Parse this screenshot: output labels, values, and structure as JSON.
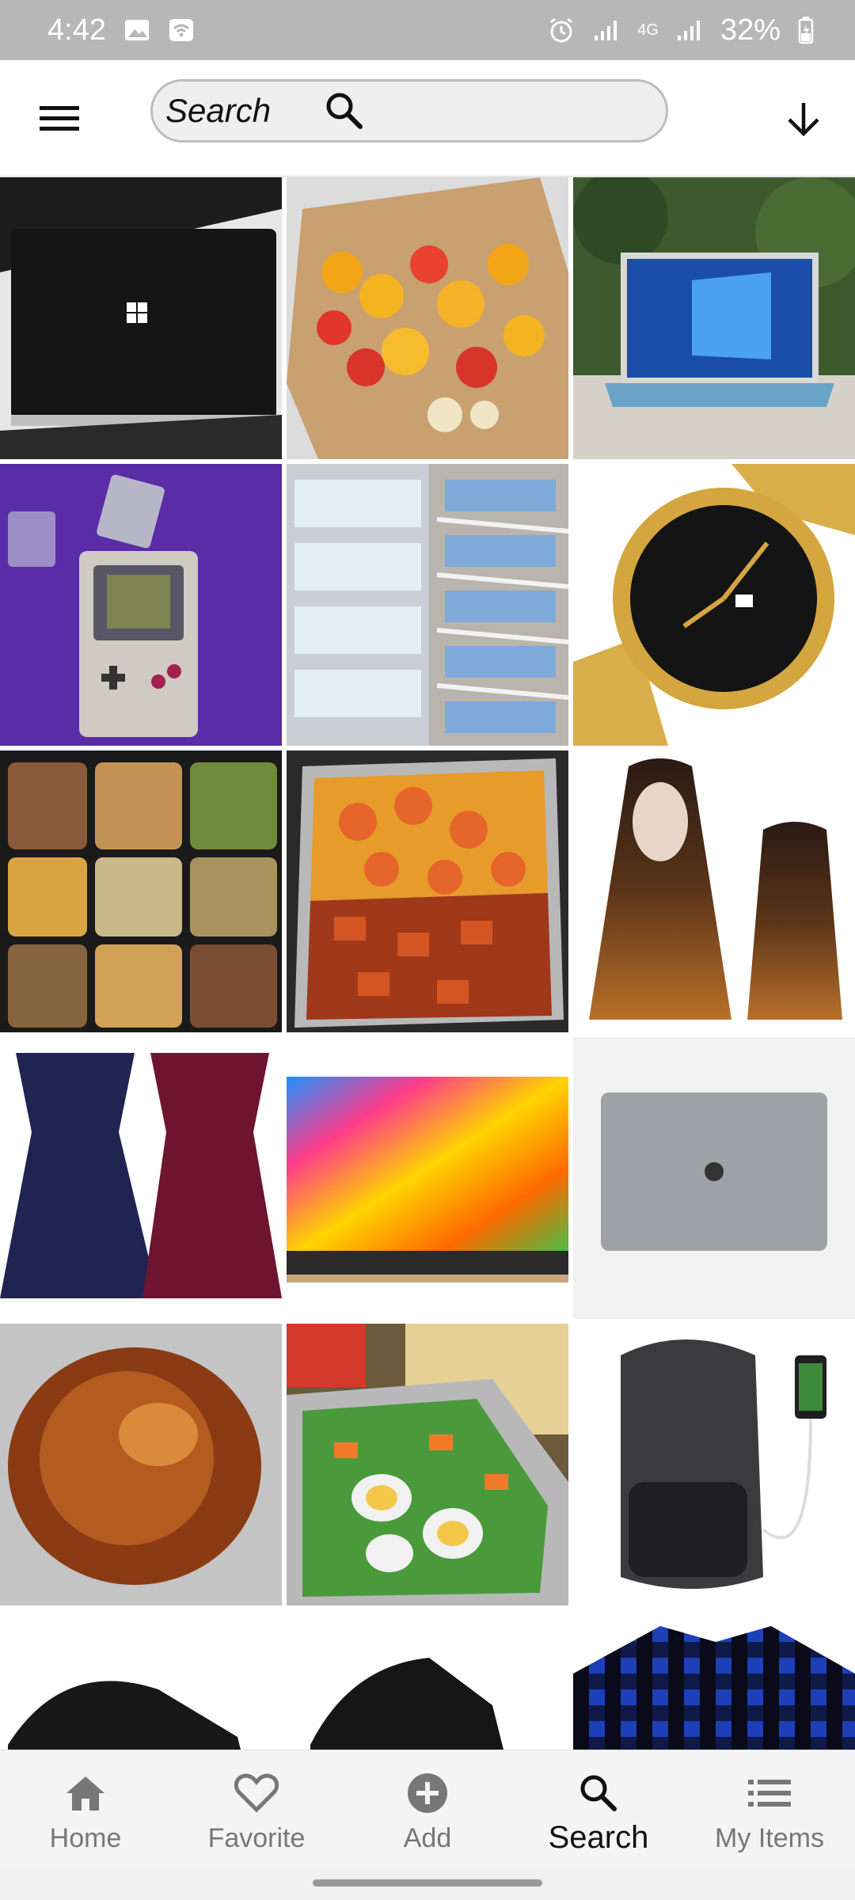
{
  "status_bar": {
    "time": "4:42",
    "battery": "32%",
    "network": "4G",
    "icons": [
      "image-icon",
      "wifi-icon",
      "alarm-icon",
      "signal-icon",
      "battery-icon"
    ]
  },
  "search": {
    "placeholder": "Search"
  },
  "grid": {
    "items": [
      {
        "name": "black-laptop"
      },
      {
        "name": "fruit-platter"
      },
      {
        "name": "surface-laptop"
      },
      {
        "name": "game-boy"
      },
      {
        "name": "water-bottles-fridge"
      },
      {
        "name": "gold-wristwatch"
      },
      {
        "name": "meal-prep-containers"
      },
      {
        "name": "shrimp-noodles-tray"
      },
      {
        "name": "ombre-wigs"
      },
      {
        "name": "off-shoulder-dresses"
      },
      {
        "name": "colorful-laptop"
      },
      {
        "name": "silver-macbook"
      },
      {
        "name": "roasted-chicken"
      },
      {
        "name": "salad-platter"
      },
      {
        "name": "backpack-usb"
      },
      {
        "name": "black-sneaker"
      },
      {
        "name": "black-sneaker-2"
      },
      {
        "name": "plaid-shirt"
      }
    ]
  },
  "bottom_nav": {
    "items": [
      {
        "label": "Home",
        "icon": "home-icon"
      },
      {
        "label": "Favorite",
        "icon": "heart-icon"
      },
      {
        "label": "Add",
        "icon": "add-circle-icon"
      },
      {
        "label": "Search",
        "icon": "search-icon",
        "active": true
      },
      {
        "label": "My Items",
        "icon": "list-icon"
      }
    ]
  },
  "colors": {
    "status_bar_bg": "#b7b7b7",
    "nav_bg": "#f4f4f4",
    "active": "#111111",
    "inactive": "#777777"
  }
}
